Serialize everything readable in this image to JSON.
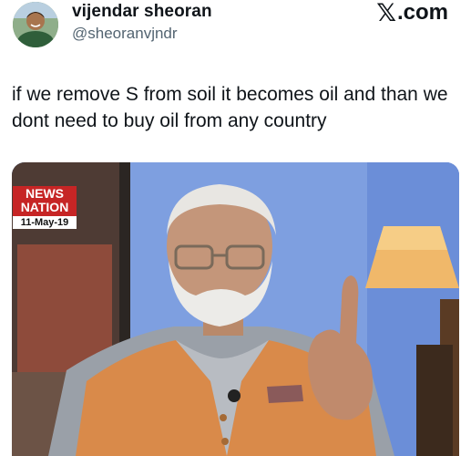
{
  "author": {
    "display_name": "vijendar sheoran",
    "handle": "@sheoranvjndr",
    "avatar_icon": "profile-photo"
  },
  "brand": {
    "label": ".com",
    "icon": "x-logo-icon"
  },
  "tweet": {
    "text": "if we remove S from soil it becomes oil and than we dont need to buy oil from any country"
  },
  "media": {
    "channel_line1": "NEWS",
    "channel_line2": "NATION",
    "date": "11-May-19",
    "colors": {
      "channel_red": "#c62525",
      "studio_blue": "#6f8fd0",
      "vest_orange": "#d98a4a"
    }
  }
}
